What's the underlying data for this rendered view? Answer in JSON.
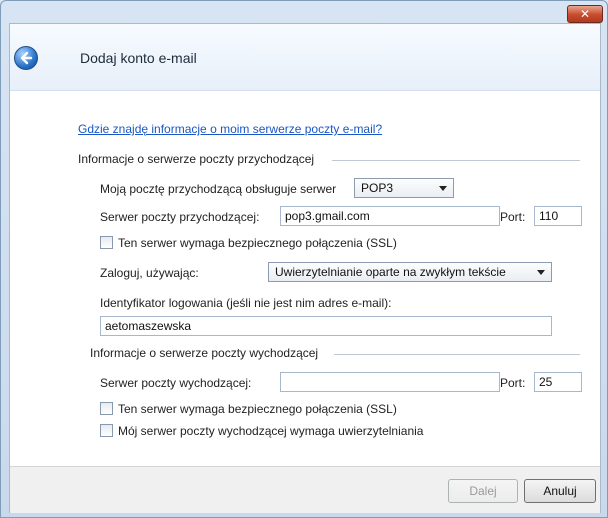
{
  "window": {
    "close_glyph": "✕"
  },
  "header": {
    "title": "Dodaj konto e-mail",
    "back_icon": "back-arrow-icon"
  },
  "help_link": "Gdzie znajdę informacje o moim serwerze poczty e-mail?",
  "incoming": {
    "group_label": "Informacje o serwerze poczty przychodzącej",
    "server_type_label": "Moją pocztę przychodzącą obsługuje serwer",
    "server_type_value": "POP3",
    "server_label": "Serwer poczty przychodzącej:",
    "server_value": "pop3.gmail.com",
    "port_label": "Port:",
    "port_value": "110",
    "ssl_label": "Ten serwer wymaga bezpiecznego połączenia (SSL)",
    "login_label": "Zaloguj, używając:",
    "login_value": "Uwierzytelnianie oparte na zwykłym tekście",
    "id_label": "Identyfikator logowania (jeśli nie jest nim adres e-mail):",
    "id_value": "aetomaszewska"
  },
  "outgoing": {
    "group_label": "Informacje o serwerze poczty wychodzącej",
    "server_label": "Serwer poczty wychodzącej:",
    "server_value": "",
    "port_label": "Port:",
    "port_value": "25",
    "ssl_label": "Ten serwer wymaga bezpiecznego połączenia (SSL)",
    "auth_label": "Mój serwer poczty wychodzącej wymaga uwierzytelniania"
  },
  "footer": {
    "next_label": "Dalej",
    "cancel_label": "Anuluj"
  }
}
